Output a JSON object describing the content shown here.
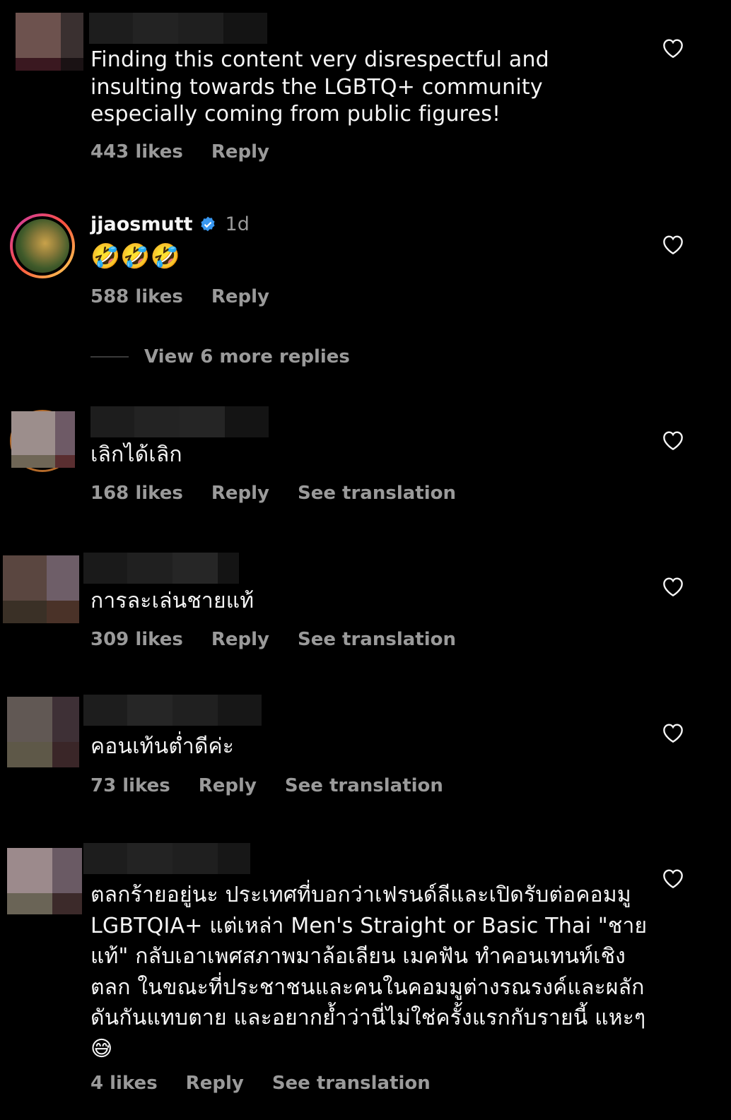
{
  "comments": [
    {
      "text": "Finding this content very disrespectful and insulting towards the LGBTQ+ community especially coming from public figures!",
      "likes": "443 likes",
      "reply": "Reply"
    },
    {
      "username": "jjaosmutt",
      "time": "1d",
      "text": "🤣🤣🤣",
      "likes": "588 likes",
      "reply": "Reply",
      "view_more": "View 6 more replies"
    },
    {
      "text": "เลิกได้เลิก",
      "likes": "168 likes",
      "reply": "Reply",
      "translate": "See translation"
    },
    {
      "text": "การละเล่นชายแท้",
      "likes": "309 likes",
      "reply": "Reply",
      "translate": "See translation"
    },
    {
      "text": "คอนเท้นต่ำดีค่ะ",
      "likes": "73 likes",
      "reply": "Reply",
      "translate": "See translation"
    },
    {
      "text": "ตลกร้ายอยู่นะ ประเทศที่บอกว่าเฟรนด์ลีและเปิดรับต่อคอมมู LGBTQIA+ แต่เหล่า Men's Straight or Basic Thai \"ชายแท้\" กลับเอาเพศสภาพมาล้อเลียน เมคฟัน ทำคอนเทนท์เชิงตลก ในขณะที่ประชาชนและคนในคอมมูต่างรณรงค์และผลักดันกันแทบตาย และอยากย้ำว่านี่ไม่ใช่ครั้งแรกกับรายนี้ แหะๆ 😅",
      "likes": "4 likes",
      "reply": "Reply",
      "translate": "See translation"
    }
  ],
  "colors": {
    "background": "#000000",
    "text": "#f5f5f5",
    "muted": "#9a9a9a",
    "verified": "#3897f0"
  }
}
